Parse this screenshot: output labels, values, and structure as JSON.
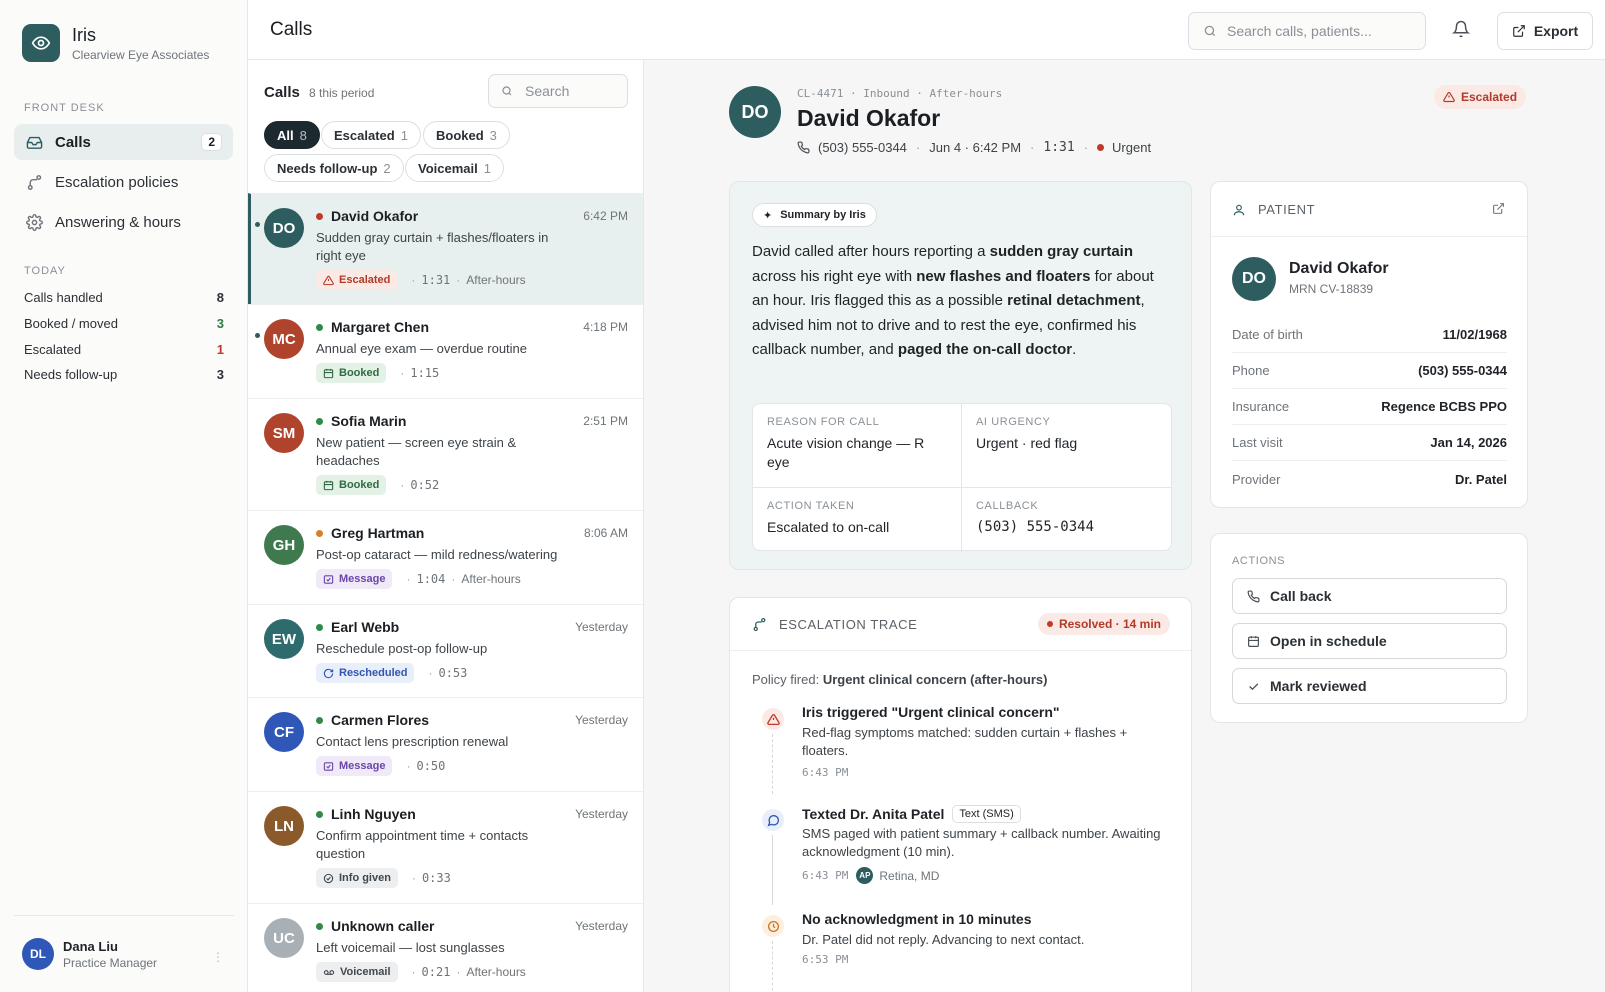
{
  "brand": {
    "name": "Iris",
    "org": "Clearview Eye Associates",
    "logo_icon": "eye-icon",
    "color": "#2d5d5f"
  },
  "sidebar": {
    "section_front_desk": "Front desk",
    "nav": [
      {
        "label": "Calls",
        "badge": "2",
        "icon": "inbox-icon",
        "active": true
      },
      {
        "label": "Escalation policies",
        "icon": "route-icon"
      },
      {
        "label": "Answering & hours",
        "icon": "gear-icon"
      }
    ],
    "section_today": "Today",
    "stats": [
      {
        "label": "Calls handled",
        "value": "8",
        "color": "#1f2328"
      },
      {
        "label": "Booked / moved",
        "value": "3",
        "color": "#2f7a45"
      },
      {
        "label": "Escalated",
        "value": "1",
        "color": "#c0392b"
      },
      {
        "label": "Needs follow-up",
        "value": "3",
        "color": "#1f2328"
      }
    ],
    "user": {
      "initials": "DL",
      "name": "Dana Liu",
      "role": "Practice Manager"
    }
  },
  "topbar": {
    "title": "Calls",
    "search_placeholder": "Search calls, patients...",
    "export_label": "Export"
  },
  "list": {
    "title": "Calls",
    "count": "8 this period",
    "search_placeholder": "Search",
    "filters": [
      {
        "label": "All",
        "count": "8",
        "active": true
      },
      {
        "label": "Escalated",
        "count": "1"
      },
      {
        "label": "Booked",
        "count": "3"
      },
      {
        "label": "Needs follow-up",
        "count": "2"
      },
      {
        "label": "Voicemail",
        "count": "1"
      }
    ],
    "calls": [
      {
        "initials": "DO",
        "name": "David Okafor",
        "time": "6:42 PM",
        "desc": "Sudden gray curtain + flashes/floaters in right eye",
        "tag": "Escalated",
        "tag_type": "esc",
        "duration": "1:31",
        "extra": "After-hours",
        "status_color": "#c0392b",
        "avatar_color": "#2d5d5f"
      },
      {
        "initials": "MC",
        "name": "Margaret Chen",
        "time": "4:18 PM",
        "desc": "Annual eye exam — overdue routine",
        "tag": "Booked",
        "tag_type": "booked",
        "duration": "1:15",
        "extra": "",
        "status_color": "#2f8a4a",
        "avatar_color": "#b0432b"
      },
      {
        "initials": "SM",
        "name": "Sofia Marin",
        "time": "2:51 PM",
        "desc": "New patient — screen eye strain & headaches",
        "tag": "Booked",
        "tag_type": "booked",
        "duration": "0:52",
        "extra": "",
        "status_color": "#2f8a4a",
        "avatar_color": "#b0432b"
      },
      {
        "initials": "GH",
        "name": "Greg Hartman",
        "time": "8:06 AM",
        "desc": "Post-op cataract — mild redness/watering",
        "tag": "Message",
        "tag_type": "msg",
        "duration": "1:04",
        "extra": "After-hours",
        "status_color": "#d4822a",
        "avatar_color": "#3f7a4e"
      },
      {
        "initials": "EW",
        "name": "Earl Webb",
        "time": "Yesterday",
        "desc": "Reschedule post-op follow-up",
        "tag": "Rescheduled",
        "tag_type": "resched",
        "duration": "0:53",
        "extra": "",
        "status_color": "#2f8a4a",
        "avatar_color": "#2d6b6d"
      },
      {
        "initials": "CF",
        "name": "Carmen Flores",
        "time": "Yesterday",
        "desc": "Contact lens prescription renewal",
        "tag": "Message",
        "tag_type": "msg",
        "duration": "0:50",
        "extra": "",
        "status_color": "#2f8a4a",
        "avatar_color": "#2f57b8"
      },
      {
        "initials": "LN",
        "name": "Linh Nguyen",
        "time": "Yesterday",
        "desc": "Confirm appointment time + contacts question",
        "tag": "Info given",
        "tag_type": "info",
        "duration": "0:33",
        "extra": "",
        "status_color": "#2f8a4a",
        "avatar_color": "#8a5a2b"
      },
      {
        "initials": "UC",
        "name": "Unknown caller",
        "time": "Yesterday",
        "desc": "Left voicemail — lost sunglasses",
        "tag": "Voicemail",
        "tag_type": "vm",
        "duration": "0:21",
        "extra": "After-hours",
        "status_color": "#2f8a4a",
        "avatar_color": "#a8b0b5"
      }
    ]
  },
  "detail": {
    "initials": "DO",
    "ids": "CL-4471 · Inbound · After-hours",
    "name": "David Okafor",
    "phone": "(503) 555-0344",
    "datetime": "Jun 4 · 6:42 PM",
    "duration": "1:31",
    "urgency": "Urgent",
    "badge": "Escalated",
    "summary_label": "Summary by Iris",
    "summary": {
      "p1": "David called after hours reporting a ",
      "b1": "sudden gray curtain",
      "p2": " across his right eye with ",
      "b2": "new flashes and floaters",
      "p3": " for about an hour. Iris flagged this as a possible ",
      "b3": "retinal detachment",
      "p4": ", advised him not to drive and to rest the eye, confirmed his callback number, and ",
      "b4": "paged the on-call doctor",
      "p5": "."
    },
    "fields": {
      "reason_label": "Reason for call",
      "reason": "Acute vision change — R eye",
      "urgency_label": "AI urgency",
      "urgency": "Urgent · red flag",
      "action_label": "Action taken",
      "action": "Escalated to on-call",
      "callback_label": "Callback",
      "callback": "(503) 555-0344"
    },
    "trace": {
      "title": "Escalation trace",
      "status": "Resolved · 14 min",
      "policy_prefix": "Policy fired: ",
      "policy": "Urgent clinical concern (after-hours)",
      "steps": [
        {
          "title": "Iris triggered \"Urgent clinical concern\"",
          "desc": "Red-flag symptoms matched: sudden curtain + flashes + floaters.",
          "time": "6:43 PM"
        },
        {
          "title": "Texted Dr. Anita Patel",
          "tag": "Text (SMS)",
          "desc": "SMS paged with patient summary + callback number. Awaiting acknowledgment (10 min).",
          "time": "6:43 PM",
          "who_initials": "AP",
          "who": "Retina, MD"
        },
        {
          "title": "No acknowledgment in 10 minutes",
          "desc": "Dr. Patel did not reply. Advancing to next contact.",
          "time": "6:53 PM"
        }
      ]
    },
    "patient": {
      "title": "Patient",
      "initials": "DO",
      "name": "David Okafor",
      "mrn": "MRN CV-18839",
      "rows": [
        {
          "k": "Date of birth",
          "v": "11/02/1968"
        },
        {
          "k": "Phone",
          "v": "(503) 555-0344"
        },
        {
          "k": "Insurance",
          "v": "Regence BCBS PPO"
        },
        {
          "k": "Last visit",
          "v": "Jan 14, 2026"
        },
        {
          "k": "Provider",
          "v": "Dr. Patel"
        }
      ]
    },
    "actions": {
      "title": "Actions",
      "call_back": "Call back",
      "open_schedule": "Open in schedule",
      "mark_reviewed": "Mark reviewed"
    }
  }
}
